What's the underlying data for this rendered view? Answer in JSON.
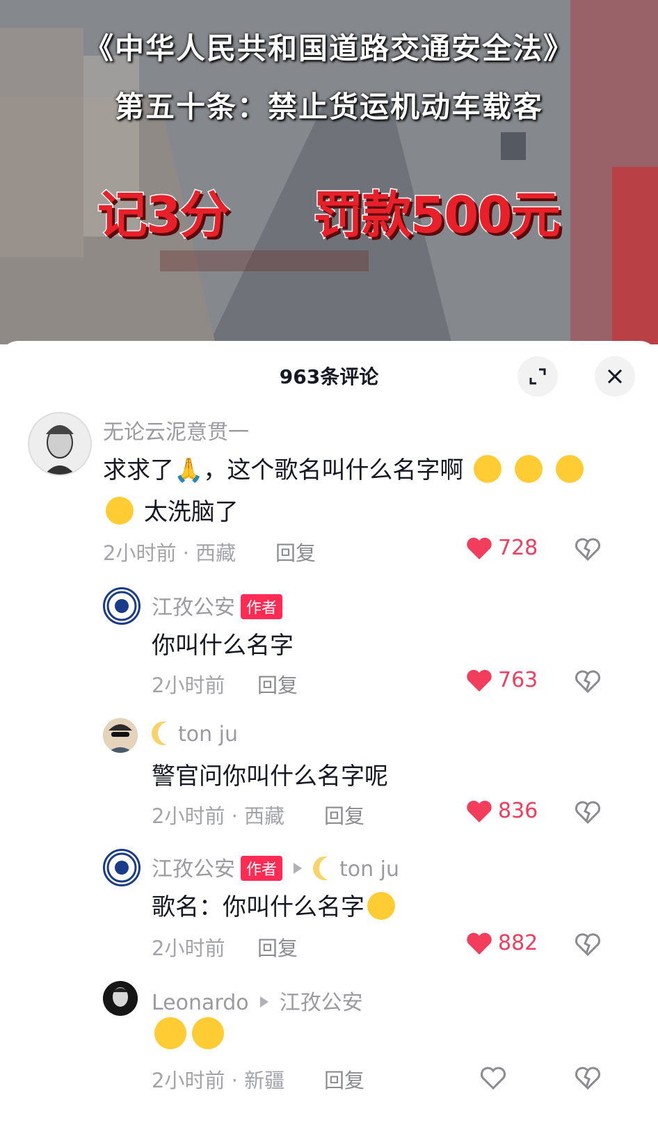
{
  "video": {
    "law_title": "《中华人民共和国道路交通安全法》",
    "law_article": "第五十条：禁止货运机动车载客",
    "penalty_points": "记3分",
    "penalty_fine": "罚款500元"
  },
  "sheet": {
    "title": "963条评论",
    "expand_icon": "expand-icon",
    "close_icon": "close-icon"
  },
  "colors": {
    "like_red": "#f23d5c",
    "badge_red": "#fe2c55",
    "text": "#161823",
    "muted": "#a3a4a9"
  },
  "comments": [
    {
      "username": "无论云泥意贯一",
      "text_line1": "求求了🙏，这个歌名叫什么名字啊",
      "text_line2": "太洗脑了",
      "time": "2小时前 · 西藏",
      "reply_label": "回复",
      "likes": "728"
    },
    {
      "username": "江孜公安",
      "badge": "作者",
      "text": "你叫什么名字",
      "time": "2小时前",
      "reply_label": "回复",
      "likes": "763"
    },
    {
      "username": "ton ju",
      "text": "警官问你叫什么名字呢",
      "time": "2小时前 · 西藏",
      "reply_label": "回复",
      "likes": "836"
    },
    {
      "username": "江孜公安",
      "badge": "作者",
      "reply_to": "ton ju",
      "text": "歌名：你叫什么名字",
      "time": "2小时前",
      "reply_label": "回复",
      "likes": "882"
    },
    {
      "username": "Leonardo",
      "reply_to": "江孜公安",
      "time": "2小时前 · 新疆",
      "reply_label": "回复"
    }
  ]
}
